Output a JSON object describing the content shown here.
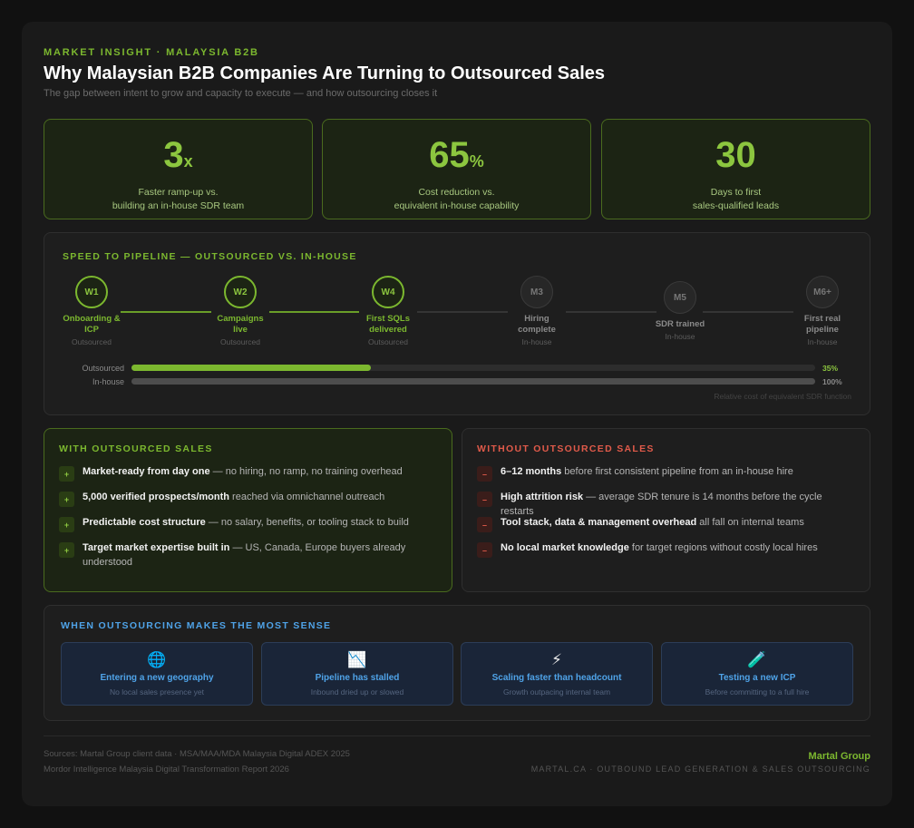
{
  "header": {
    "eyebrow": "MARKET INSIGHT · MALAYSIA B2B",
    "title": "Why Malaysian B2B Companies Are Turning to Outsourced Sales",
    "subtitle": "The gap between intent to grow and capacity to execute — and how outsourcing closes it"
  },
  "stats": [
    {
      "value": "3",
      "suffix": "x",
      "line1": "Faster ramp-up vs.",
      "line2": "building an in-house SDR team"
    },
    {
      "value": "65",
      "suffix": "%",
      "line1": "Cost reduction vs.",
      "line2": "equivalent in-house capability"
    },
    {
      "value": "30",
      "suffix": "",
      "line1": "Days to first",
      "line2": "sales-qualified leads"
    }
  ],
  "timeline": {
    "title": "SPEED TO PIPELINE — OUTSOURCED VS. IN-HOUSE",
    "steps": [
      {
        "badge": "W1",
        "label1": "Onboarding &",
        "label2": "ICP",
        "sub": "Outsourced"
      },
      {
        "badge": "W2",
        "label1": "Campaigns",
        "label2": "live",
        "sub": "Outsourced"
      },
      {
        "badge": "W4",
        "label1": "First SQLs",
        "label2": "delivered",
        "sub": "Outsourced"
      },
      {
        "badge": "M3",
        "label1": "Hiring",
        "label2": "complete",
        "sub": "In-house"
      },
      {
        "badge": "M5",
        "label1": "SDR trained",
        "label2": "",
        "sub": "In-house"
      },
      {
        "badge": "M6+",
        "label1": "First real",
        "label2": "pipeline",
        "sub": "In-house"
      }
    ],
    "bars": [
      {
        "label": "Outsourced",
        "pct_label": "35%",
        "value": 35,
        "color": "#7cb82f"
      },
      {
        "label": "In-house",
        "pct_label": "100%",
        "value": 100,
        "color": "#4d4d4d"
      }
    ],
    "note": "Relative cost of equivalent SDR function"
  },
  "with": {
    "title": "WITH OUTSOURCED SALES",
    "items": [
      {
        "bold": "Market-ready from day one",
        "rest": " — no hiring, no ramp, no training overhead"
      },
      {
        "bold": "5,000 verified prospects/month",
        "rest": " reached via omnichannel outreach"
      },
      {
        "bold": "Predictable cost structure",
        "rest": " — no salary, benefits, or tooling stack to build"
      },
      {
        "bold": "Target market expertise built in",
        "rest": " — US, Canada, Europe buyers already understood"
      }
    ]
  },
  "without": {
    "title": "WITHOUT OUTSOURCED SALES",
    "items": [
      {
        "bold": "6–12 months",
        "rest": " before first consistent pipeline from an in-house hire"
      },
      {
        "bold": "High attrition risk",
        "rest": " — average SDR tenure is 14 months before the cycle restarts"
      },
      {
        "bold": "Tool stack, data & management overhead",
        "rest": " all fall on internal teams"
      },
      {
        "bold": "No local market knowledge",
        "rest": " for target regions without costly local hires"
      }
    ]
  },
  "when": {
    "title": "WHEN OUTSOURCING MAKES THE MOST SENSE",
    "tiles": [
      {
        "icon": "🌐",
        "title": "Entering a new geography",
        "sub": "No local sales presence yet"
      },
      {
        "icon": "📉",
        "title": "Pipeline has stalled",
        "sub": "Inbound dried up or slowed"
      },
      {
        "icon": "⚡",
        "title": "Scaling faster than headcount",
        "sub": "Growth outpacing internal team"
      },
      {
        "icon": "🧪",
        "title": "Testing a new ICP",
        "sub": "Before committing to a full hire"
      }
    ]
  },
  "footer": {
    "source1": "Sources: Martal Group client data · MSA/MAA/MDA Malaysia Digital ADEX 2025",
    "source2": "Mordor Intelligence Malaysia Digital Transformation Report 2026",
    "brand": "Martal Group",
    "tagline": "MARTAL.CA · OUTBOUND LEAD GENERATION & SALES OUTSOURCING"
  }
}
